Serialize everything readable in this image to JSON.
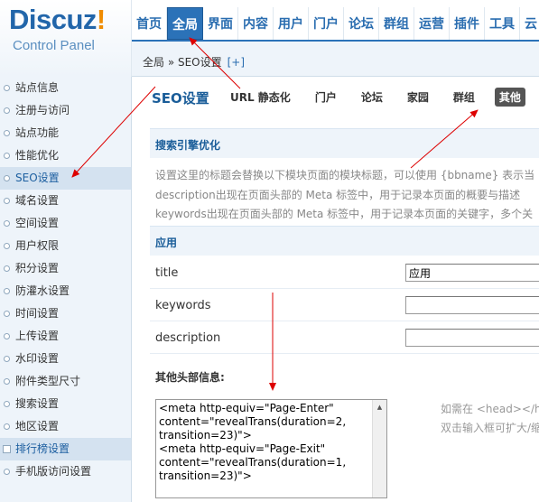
{
  "logo": {
    "brand": "Discuz",
    "bang": "!",
    "subtitle": "Control Panel"
  },
  "topnav": [
    "首页",
    "全局",
    "界面",
    "内容",
    "用户",
    "门户",
    "论坛",
    "群组",
    "运营",
    "插件",
    "工具",
    "云"
  ],
  "breadcrumb": {
    "path": "全局 » SEO设置",
    "add": "[+]"
  },
  "sidebar": [
    "站点信息",
    "注册与访问",
    "站点功能",
    "性能优化",
    "SEO设置",
    "域名设置",
    "空间设置",
    "用户权限",
    "积分设置",
    "防灌水设置",
    "时间设置",
    "上传设置",
    "水印设置",
    "附件类型尺寸",
    "搜索设置",
    "地区设置",
    "排行榜设置",
    "手机版访问设置"
  ],
  "main": {
    "title": "SEO设置",
    "subtabs": [
      "URL 静态化",
      "门户",
      "论坛",
      "家园",
      "群组",
      "其他"
    ],
    "section1": "搜索引擎优化",
    "desc": [
      "设置这里的标题会替换以下模块页面的模块标题，可以使用 {bbname} 表示当",
      "description出现在页面头部的 Meta 标签中，用于记录本页面的概要与描述",
      "keywords出现在页面头部的 Meta 标签中，用于记录本页面的关键字，多个关"
    ],
    "section2": "应用",
    "fields": [
      {
        "label": "title",
        "value": "应用"
      },
      {
        "label": "keywords",
        "value": ""
      },
      {
        "label": "description",
        "value": ""
      }
    ],
    "other_label": "其他头部信息:",
    "head_text": "<meta http-equiv=\"Page-Enter\" content=\"revealTrans(duration=2, transition=23)\">\n<meta http-equiv=\"Page-Exit\" content=\"revealTrans(duration=1, transition=23)\">",
    "hint1": "如需在 <head></h",
    "hint2": "双击输入框可扩大/缩"
  },
  "colors": {
    "accent": "#2b72b8",
    "arrow": "#dd0000",
    "panel": "#eef4fa"
  }
}
